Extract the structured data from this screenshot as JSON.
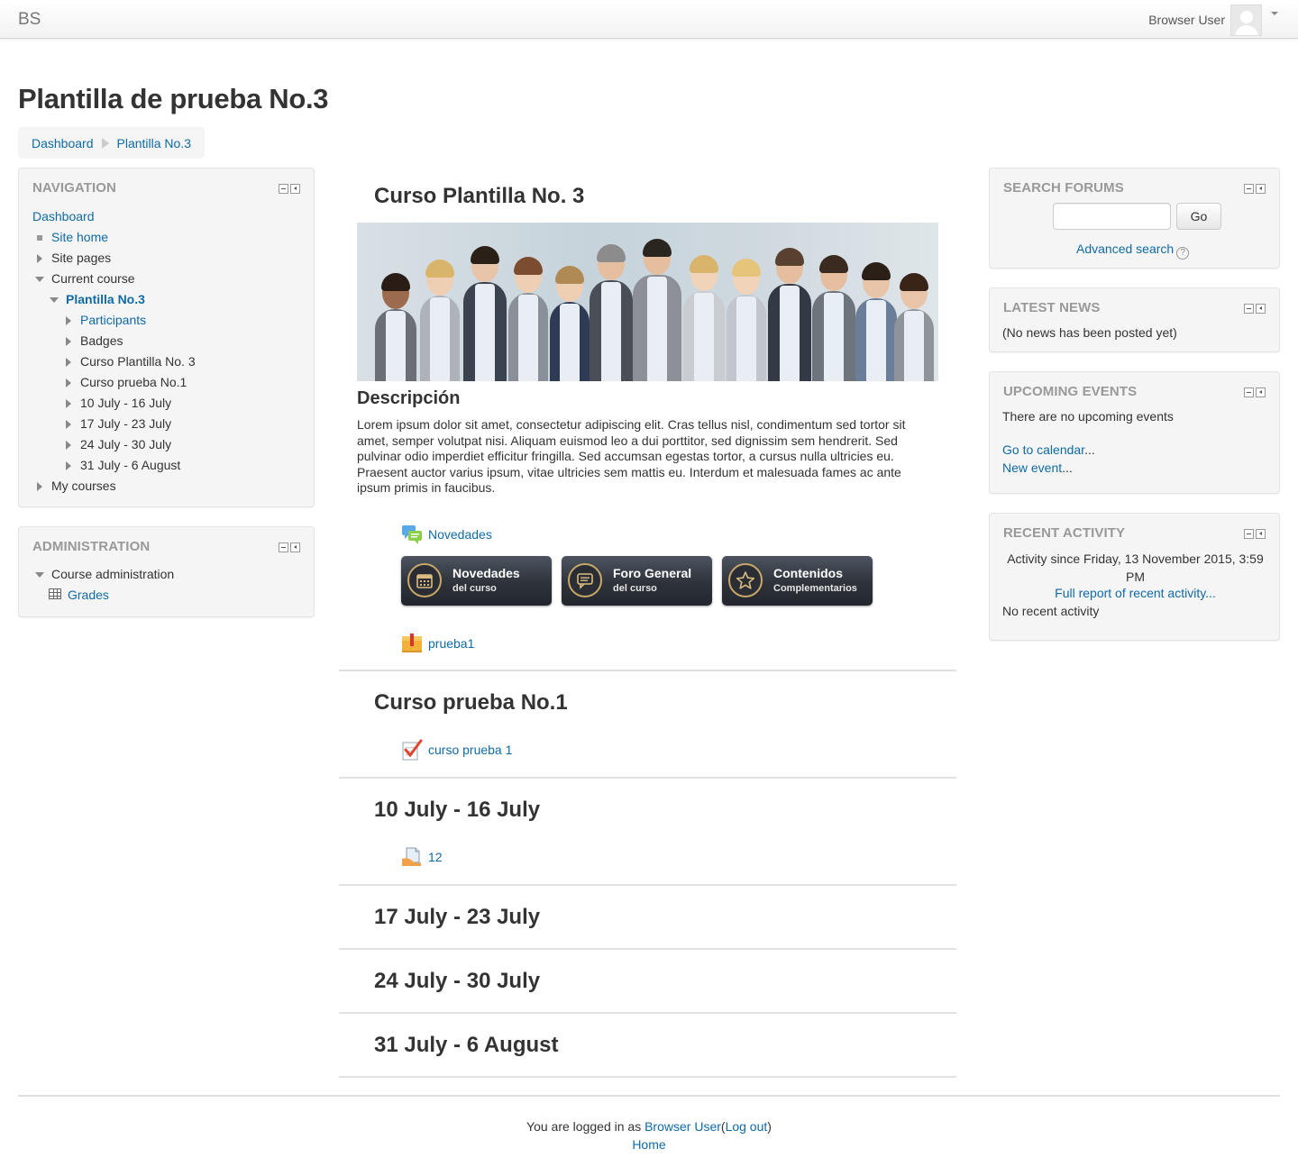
{
  "navbar": {
    "brand": "BS",
    "user_name": "Browser User"
  },
  "page": {
    "title": "Plantilla de prueba No.3"
  },
  "breadcrumb": [
    "Dashboard",
    "Plantilla No.3"
  ],
  "navigation": {
    "title": "NAVIGATION",
    "items": [
      "Dashboard",
      "Site home",
      "Site pages",
      "Current course",
      "Plantilla No.3",
      "Participants",
      "Badges",
      "Curso Plantilla No. 3",
      "Curso prueba No.1",
      "10 July - 16 July",
      "17 July - 23 July",
      "24 July - 30 July",
      "31 July - 6 August",
      "My courses"
    ]
  },
  "administration": {
    "title": "ADMINISTRATION",
    "items": [
      "Course administration",
      "Grades"
    ]
  },
  "main": {
    "section0": {
      "title": "Curso Plantilla No. 3",
      "desc_title": "Descripción",
      "desc_text": "Lorem ipsum dolor sit amet, consectetur adipiscing elit. Cras tellus nisl, condimentum sed tortor sit amet, semper volutpat nisi. Aliquam euismod leo a dui porttitor, sed dignissim sem hendrerit. Sed pulvinar odio imperdiet efficitur fringilla. Sed accumsan egestas tortor, a cursus nulla ultricies eu. Praesent auctor varius ipsum, vitae ultricies sem mattis eu. Interdum et malesuada fames ac ante ipsum primis in faucibus.",
      "forum_link": "Novedades",
      "buttons": [
        {
          "line1": "Novedades",
          "line2": "del curso",
          "icon": "calendar-icon"
        },
        {
          "line1": "Foro General",
          "line2": "del curso",
          "icon": "chat-icon"
        },
        {
          "line1": "Contenidos",
          "line2": "Complementarios",
          "icon": "star-icon"
        }
      ],
      "resource_link": "prueba1"
    },
    "section1": {
      "title": "Curso prueba No.1",
      "activity": "curso prueba 1"
    },
    "section2": {
      "title": "10 July - 16 July",
      "activity": "12"
    },
    "section3": {
      "title": "17 July - 23 July"
    },
    "section4": {
      "title": "24 July - 30 July"
    },
    "section5": {
      "title": "31 July - 6 August"
    }
  },
  "search_forums": {
    "title": "SEARCH FORUMS",
    "go_label": "Go",
    "advanced": "Advanced search"
  },
  "latest_news": {
    "title": "LATEST NEWS",
    "text": "(No news has been posted yet)"
  },
  "upcoming_events": {
    "title": "UPCOMING EVENTS",
    "text": "There are no upcoming events",
    "calendar_link": "Go to calendar",
    "new_event_link": "New event",
    "ellipsis": "..."
  },
  "recent_activity": {
    "title": "RECENT ACTIVITY",
    "since": "Activity since Friday, 13 November 2015, 3:59 PM",
    "full_report": "Full report of recent activity...",
    "none": "No recent activity"
  },
  "footer": {
    "logged_in_prefix": "You are logged in as",
    "user": "Browser User",
    "logout": "Log out",
    "open_paren": "(",
    "close_paren": ")",
    "home": "Home"
  },
  "colors": {
    "link": "#0f6aa6",
    "block_bg": "#f5f5f5",
    "block_title": "#999999"
  }
}
